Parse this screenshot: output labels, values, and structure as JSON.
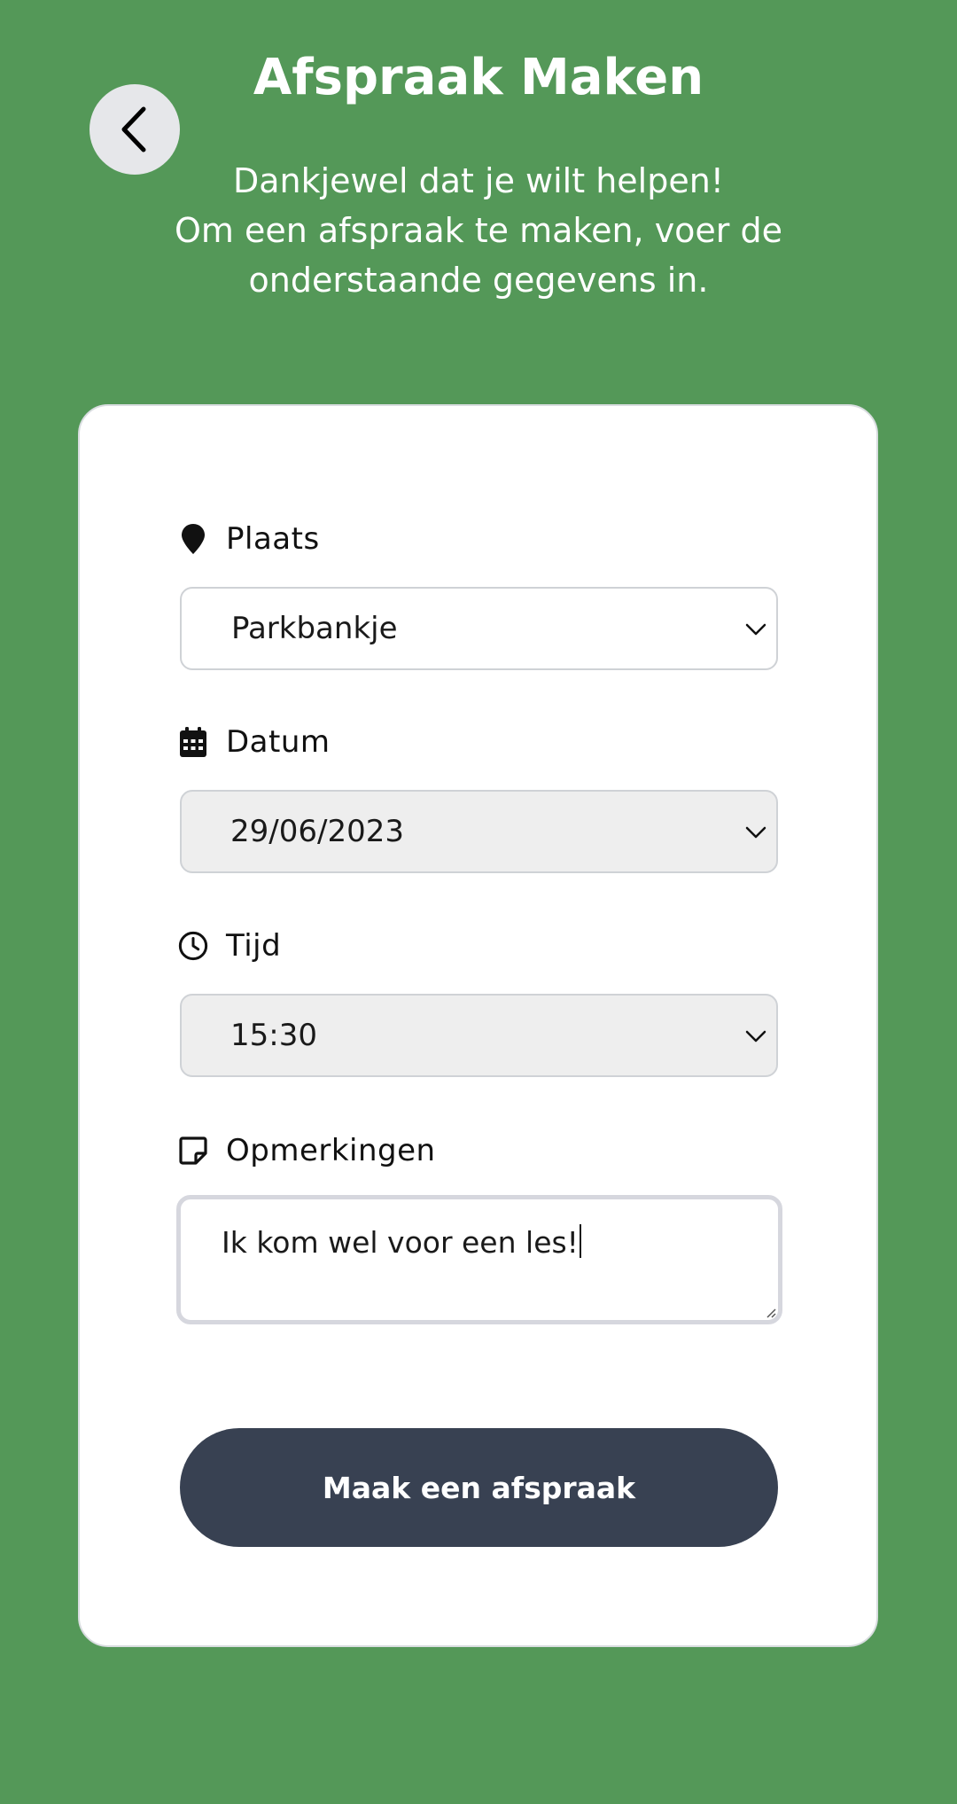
{
  "header": {
    "title": "Afspraak Maken",
    "intro_lines": [
      "Dankjewel dat je wilt helpen!",
      "Om een afspraak te maken, voer de",
      "onderstaande gegevens in."
    ]
  },
  "form": {
    "place": {
      "label": "Plaats",
      "icon": "map-pin-icon",
      "value": "Parkbankje"
    },
    "date": {
      "label": "Datum",
      "icon": "calendar-icon",
      "value": "29/06/2023"
    },
    "time": {
      "label": "Tijd",
      "icon": "clock-icon",
      "value": "15:30"
    },
    "notes": {
      "label": "Opmerkingen",
      "icon": "note-icon",
      "value": "Ik kom wel voor een les!"
    },
    "submit_label": "Maak een afspraak"
  },
  "colors": {
    "background": "#549858",
    "card": "#ffffff",
    "button": "#384152",
    "field_disabled": "#eeeeee"
  }
}
